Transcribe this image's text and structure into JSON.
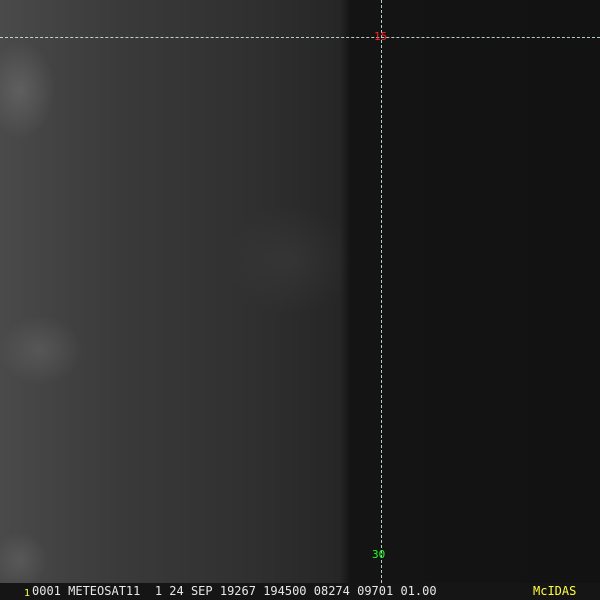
{
  "grid_labels": {
    "latitude": "15",
    "longitude": "30"
  },
  "colors": {
    "latitude_label": "#ff2020",
    "longitude_label": "#20ff20",
    "grid_line": "#d0eef0",
    "brand": "#ffff40"
  },
  "status_bar": {
    "frame_number": "1",
    "info": "0001 METEOSAT11  1 24 SEP 19267 194500 08274 09701 01.00",
    "brand": "McIDAS"
  }
}
